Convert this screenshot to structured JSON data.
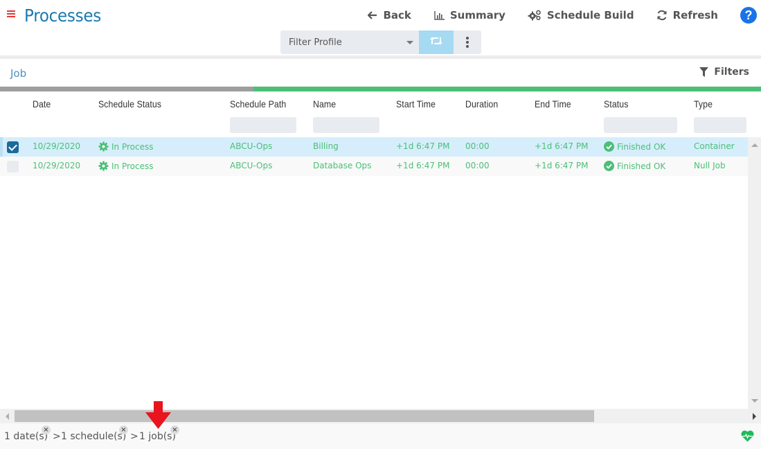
{
  "header": {
    "title": "Processes",
    "toolbar": [
      {
        "id": "back",
        "label": "Back",
        "icon": "arrow-left-icon"
      },
      {
        "id": "summary",
        "label": "Summary",
        "icon": "bar-chart-icon"
      },
      {
        "id": "schedule_build",
        "label": "Schedule Build",
        "icon": "gears-icon"
      },
      {
        "id": "refresh",
        "label": "Refresh",
        "icon": "refresh-icon"
      }
    ],
    "help_label": "?"
  },
  "filter_profile": {
    "selected": "Filter Profile"
  },
  "section": {
    "title": "Job",
    "filters_label": "Filters",
    "progress_complete_fraction": 0.333
  },
  "table": {
    "columns": [
      "Date",
      "Schedule Status",
      "Schedule Path",
      "Name",
      "Start Time",
      "Duration",
      "End Time",
      "Status",
      "Type"
    ],
    "rows": [
      {
        "checked": true,
        "date": "10/29/2020",
        "schedule_status": "In Process",
        "schedule_path": "ABCU-Ops",
        "name": "Billing",
        "start_time": "+1d 6:47 PM",
        "duration": "00:00",
        "end_time": "+1d 6:47 PM",
        "status": "Finished OK",
        "type": "Container"
      },
      {
        "checked": false,
        "date": "10/29/2020",
        "schedule_status": "In Process",
        "schedule_path": "ABCU-Ops",
        "name": "Database Ops",
        "start_time": "+1d 6:47 PM",
        "duration": "00:00",
        "end_time": "+1d 6:47 PM",
        "status": "Finished OK",
        "type": "Null Job"
      }
    ]
  },
  "breadcrumbs": [
    {
      "label": "1 date(s)"
    },
    {
      "label": "1 schedule(s)"
    },
    {
      "label": "1 job(s)"
    }
  ],
  "breadcrumb_separator": ">",
  "breadcrumb_remove": "×",
  "colors": {
    "accent": "#1a7ab0",
    "success": "#4cbe78",
    "menu": "#e53935",
    "selected_row": "#d6eefb",
    "help": "#1a73e8"
  }
}
